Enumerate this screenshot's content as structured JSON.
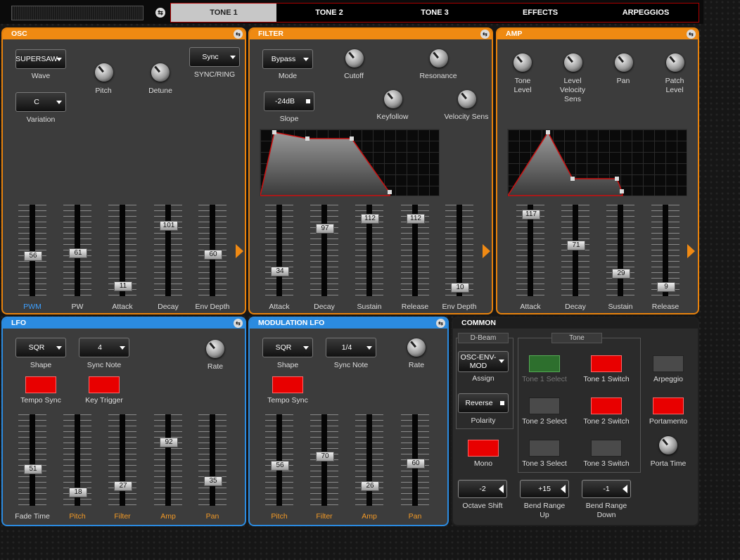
{
  "tabs": [
    "TONE 1",
    "TONE 2",
    "TONE 3",
    "EFFECTS",
    "ARPEGGIOS"
  ],
  "osc": {
    "title": "OSC",
    "wave": {
      "value": "SUPERSAW",
      "label": "Wave"
    },
    "sync": {
      "value": "Sync",
      "label": "SYNC/RING"
    },
    "variation": {
      "value": "C",
      "label": "Variation"
    },
    "pitch_label": "Pitch",
    "detune_label": "Detune",
    "faders": [
      {
        "label": "PWM",
        "value": "56"
      },
      {
        "label": "PW",
        "value": "61"
      },
      {
        "label": "Attack",
        "value": "11"
      },
      {
        "label": "Decay",
        "value": "101"
      },
      {
        "label": "Env Depth",
        "value": "60"
      }
    ]
  },
  "filter": {
    "title": "FILTER",
    "mode": {
      "value": "Bypass",
      "label": "Mode"
    },
    "cutoff_label": "Cutoff",
    "resonance_label": "Resonance",
    "slope": {
      "value": "-24dB",
      "label": "Slope"
    },
    "keyfollow_label": "Keyfollow",
    "velsens_label": "Velocity Sens",
    "faders": [
      {
        "label": "Attack",
        "value": "34"
      },
      {
        "label": "Decay",
        "value": "97"
      },
      {
        "label": "Sustain",
        "value": "112"
      },
      {
        "label": "Release",
        "value": "112"
      },
      {
        "label": "Env Depth",
        "value": "10"
      }
    ]
  },
  "amp": {
    "title": "AMP",
    "knobs": [
      "Tone\nLevel",
      "Level\nVelocity\nSens",
      "Pan",
      "Patch\nLevel"
    ],
    "faders": [
      {
        "label": "Attack",
        "value": "117"
      },
      {
        "label": "Decay",
        "value": "71"
      },
      {
        "label": "Sustain",
        "value": "29"
      },
      {
        "label": "Release",
        "value": "9"
      }
    ]
  },
  "lfo": {
    "title": "LFO",
    "shape": {
      "value": "SQR",
      "label": "Shape"
    },
    "sync_note": {
      "value": "4",
      "label": "Sync Note"
    },
    "rate_label": "Rate",
    "tempo_sync_label": "Tempo Sync",
    "key_trigger_label": "Key Trigger",
    "faders": [
      {
        "label": "Fade Time",
        "value": "51"
      },
      {
        "label": "Pitch",
        "value": "18"
      },
      {
        "label": "Filter",
        "value": "27"
      },
      {
        "label": "Amp",
        "value": "92"
      },
      {
        "label": "Pan",
        "value": "35"
      }
    ]
  },
  "modlfo": {
    "title": "MODULATION LFO",
    "shape": {
      "value": "SQR",
      "label": "Shape"
    },
    "sync_note": {
      "value": "1/4",
      "label": "Sync Note"
    },
    "rate_label": "Rate",
    "tempo_sync_label": "Tempo Sync",
    "faders": [
      {
        "label": "Pitch",
        "value": "56"
      },
      {
        "label": "Filter",
        "value": "70"
      },
      {
        "label": "Amp",
        "value": "26"
      },
      {
        "label": "Pan",
        "value": "60"
      }
    ]
  },
  "common": {
    "title": "COMMON",
    "dbeam_title": "D-Beam",
    "assign": {
      "value": "OSC-ENV-MOD",
      "label": "Assign"
    },
    "polarity": {
      "value": "Reverse",
      "label": "Polarity"
    },
    "mono_label": "Mono",
    "tone_title": "Tone",
    "tone_buttons": [
      "Tone 1 Select",
      "Tone 1 Switch",
      "Tone 2 Select",
      "Tone 2 Switch",
      "Tone 3 Select",
      "Tone 3 Switch"
    ],
    "arpeggio_label": "Arpeggio",
    "portamento_label": "Portamento",
    "porta_time_label": "Porta Time",
    "octave_shift": {
      "value": "-2",
      "label": "Octave Shift"
    },
    "bend_up": {
      "value": "+15",
      "label": "Bend Range\nUp"
    },
    "bend_down": {
      "value": "-1",
      "label": "Bend Range\nDown"
    }
  },
  "colors": {
    "orange": "#ef8a12",
    "blue": "#2b8be0",
    "red": "#e80000",
    "green": "#2d6f2d"
  }
}
